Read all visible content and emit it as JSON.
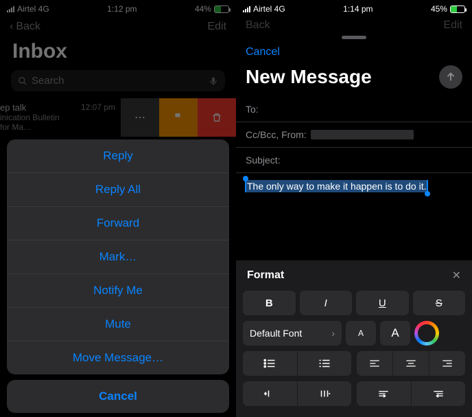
{
  "left": {
    "statusbar": {
      "carrier": "Airtel 4G",
      "time": "1:12 pm",
      "battery": "44%"
    },
    "nav": {
      "back": "Back",
      "edit": "Edit"
    },
    "title": "Inbox",
    "search": {
      "placeholder": "Search"
    },
    "message": {
      "time": "12:07 pm",
      "title": "ep talk",
      "preview": "inication Bulletin for Ma…"
    },
    "actions": {
      "items": [
        "Reply",
        "Reply All",
        "Forward",
        "Mark…",
        "Notify Me",
        "Mute",
        "Move Message…"
      ],
      "cancel": "Cancel"
    }
  },
  "right": {
    "statusbar": {
      "carrier": "Airtel 4G",
      "time": "1:14 pm",
      "battery": "45%"
    },
    "dimmed_nav": {
      "back": "Back",
      "edit": "Edit"
    },
    "cancel": "Cancel",
    "title": "New Message",
    "fields": {
      "to": "To:",
      "ccbcc": "Cc/Bcc, From:",
      "subject": "Subject:"
    },
    "body_text": "The only way to make it happen is to do it.",
    "format": {
      "title": "Format",
      "bold": "B",
      "italic": "I",
      "underline": "U",
      "strike": "S",
      "font": "Default Font",
      "size_small": "A",
      "size_large": "A"
    }
  }
}
